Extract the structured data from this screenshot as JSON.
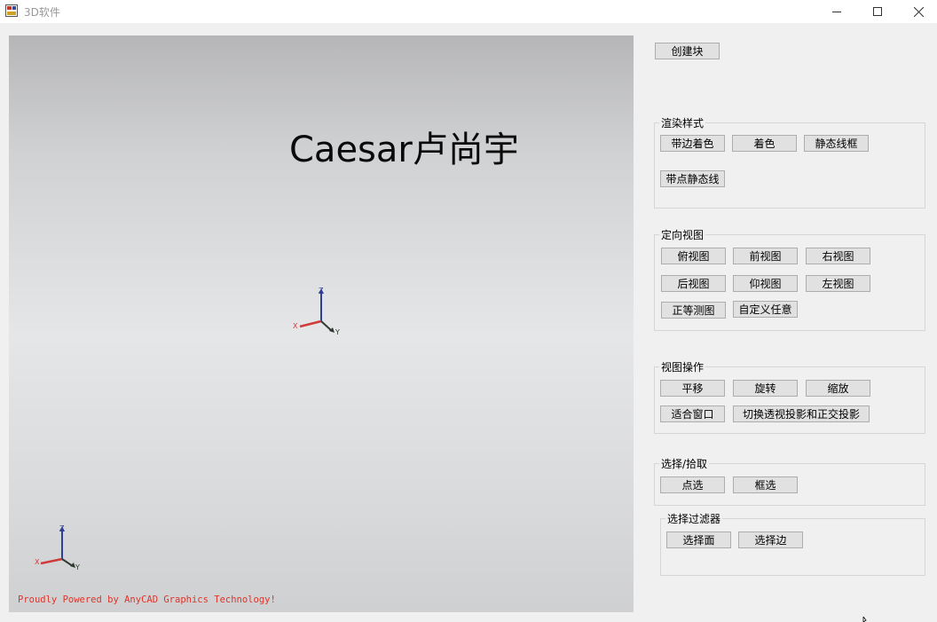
{
  "window": {
    "title": "3D软件",
    "controls": {
      "minimize_icon": "minimize-icon",
      "maximize_icon": "maximize-icon",
      "close_icon": "close-icon"
    }
  },
  "viewport": {
    "title_text": "Caesar卢尚宇",
    "axis_labels": {
      "x": "X",
      "y": "Y",
      "z": "Z"
    },
    "axis_colors": {
      "x": "#d03a3a",
      "y": "#2f3a30",
      "z": "#2f3f96"
    },
    "powered_text": "Proudly Powered by AnyCAD Graphics Technology!",
    "powered_color": "#e0342a"
  },
  "panel": {
    "create_block": "创建块",
    "render_style": {
      "legend": "渲染样式",
      "buttons": [
        "带边着色",
        "着色",
        "静态线框",
        "带点静态线"
      ]
    },
    "orient_view": {
      "legend": "定向视图",
      "buttons": [
        "俯视图",
        "前视图",
        "右视图",
        "后视图",
        "仰视图",
        "左视图",
        "正等测图",
        "自定义任意"
      ]
    },
    "view_ops": {
      "legend": "视图操作",
      "buttons": [
        "平移",
        "旋转",
        "缩放",
        "适合窗口",
        "切换透视投影和正交投影"
      ]
    },
    "select_pick": {
      "legend": "选择/拾取",
      "buttons": [
        "点选",
        "框选"
      ]
    },
    "select_filter": {
      "legend": "选择过滤器",
      "buttons": [
        "选择面",
        "选择边"
      ]
    }
  }
}
